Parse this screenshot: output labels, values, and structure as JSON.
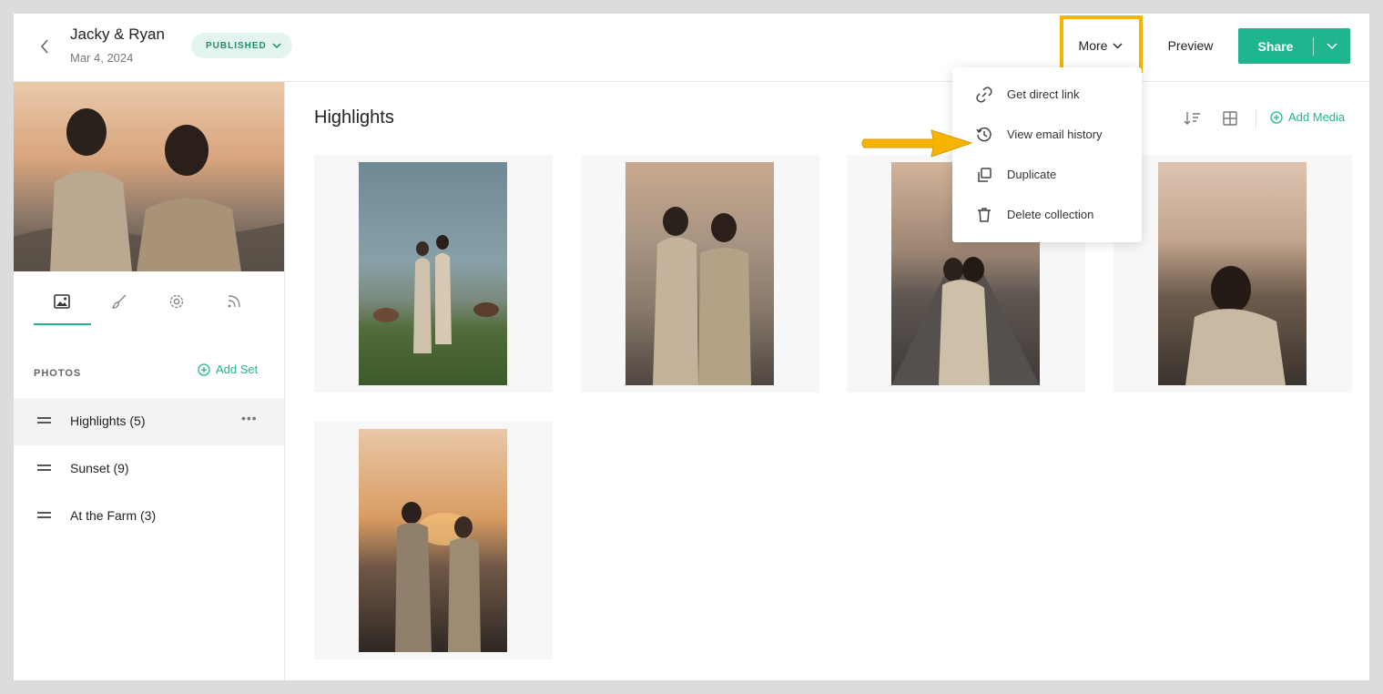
{
  "header": {
    "title": "Jacky & Ryan",
    "date": "Mar 4, 2024",
    "status": "PUBLISHED",
    "more_label": "More",
    "preview_label": "Preview",
    "share_label": "Share"
  },
  "sidebar": {
    "photos_label": "PHOTOS",
    "add_set_label": "Add Set",
    "tabs": [
      "photos-icon",
      "brush-icon",
      "gear-icon",
      "rss-icon"
    ],
    "sets": [
      {
        "label": "Highlights (5)",
        "active": true
      },
      {
        "label": "Sunset (9)",
        "active": false
      },
      {
        "label": "At the Farm (3)",
        "active": false
      }
    ]
  },
  "main": {
    "title": "Highlights",
    "add_media_label": "Add Media"
  },
  "more_menu": {
    "items": [
      {
        "label": "Get direct link",
        "icon": "link-icon"
      },
      {
        "label": "View email history",
        "icon": "history-icon"
      },
      {
        "label": "Duplicate",
        "icon": "duplicate-icon"
      },
      {
        "label": "Delete collection",
        "icon": "trash-icon"
      }
    ]
  },
  "colors": {
    "accent": "#21b58f",
    "highlight": "#f6b400",
    "status_bg": "#e3f5ee"
  }
}
